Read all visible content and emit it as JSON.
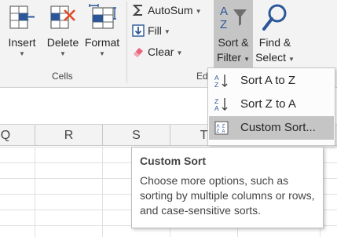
{
  "ribbon": {
    "cells_group": {
      "label": "Cells",
      "insert": "Insert",
      "delete": "Delete",
      "format": "Format"
    },
    "editing_group": {
      "label_partial": "Ed",
      "autosum": "AutoSum",
      "fill": "Fill",
      "clear": "Clear",
      "sort_filter_line1": "Sort &",
      "sort_filter_line2": "Filter",
      "find_select_line1": "Find &",
      "find_select_line2": "Select"
    }
  },
  "sheet": {
    "columns": [
      "Q",
      "R",
      "S",
      "T"
    ]
  },
  "sort_menu": {
    "items": [
      {
        "label": "Sort A to Z"
      },
      {
        "label": "Sort Z to A"
      },
      {
        "label": "Custom Sort...",
        "highlighted": true
      }
    ]
  },
  "tooltip": {
    "title": "Custom Sort",
    "body": "Choose more options, such as sorting by multiple columns or rows, and case-sensitive sorts."
  },
  "colors": {
    "accent_blue": "#2b579a",
    "delete_red": "#e04a2a",
    "ribbon_bg": "#f3f3f3",
    "pressed_button": "#c5c5c5"
  }
}
